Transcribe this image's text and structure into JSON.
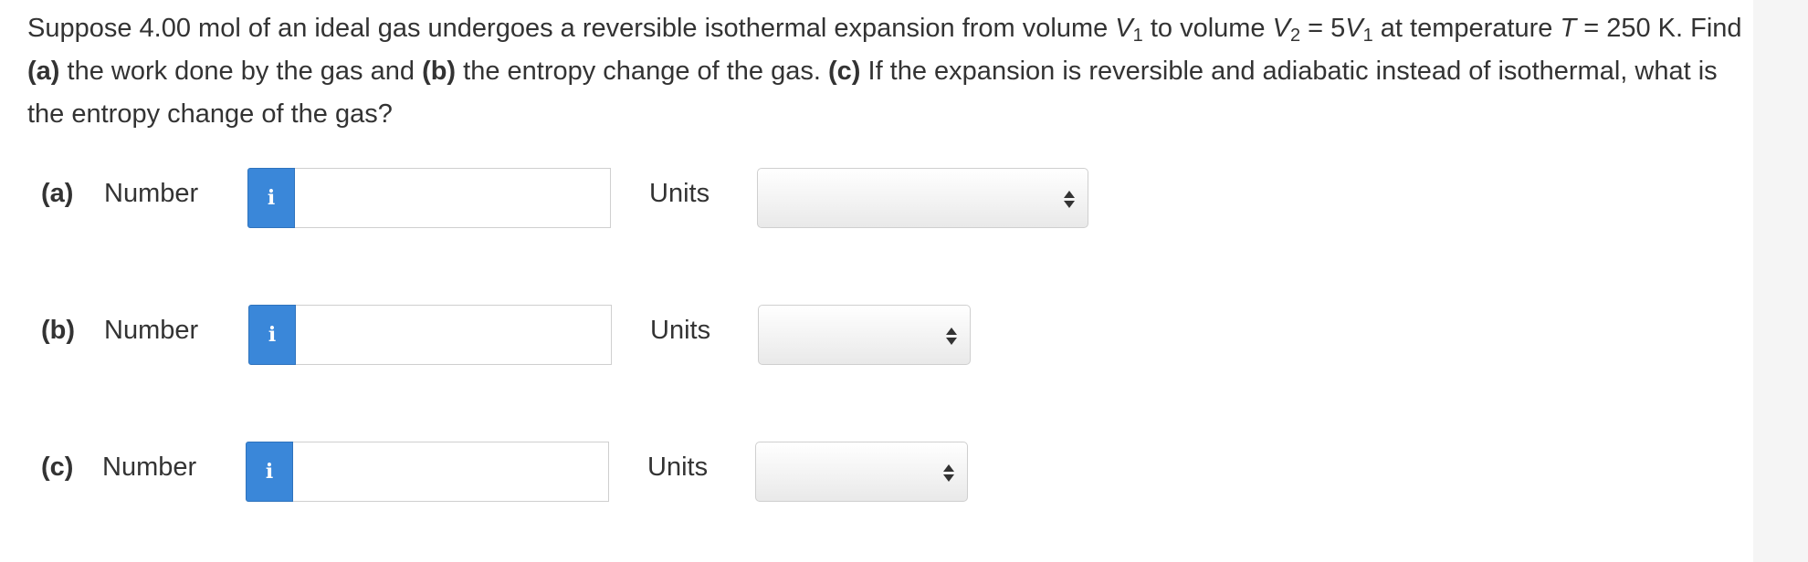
{
  "question": {
    "t1": "Suppose 4.00 mol of an ideal gas undergoes a reversible isothermal expansion from volume ",
    "v": "V",
    "sub1": "1",
    "t2": " to volume ",
    "sub2": "2",
    "t3": " = 5",
    "t4": " at temperature ",
    "T": "T",
    "t5": " = 250 K. Find ",
    "a": "(a)",
    "t6": " the work done by the gas and ",
    "b": "(b)",
    "t7": " the entropy change of the gas. ",
    "c": "(c)",
    "t8": " If the expansion is reversible and adiabatic instead of isothermal, what is the entropy change of the gas?"
  },
  "parts": [
    {
      "label": "(a)",
      "number_label": "Number",
      "info_icon": "i",
      "input_value": "",
      "units_label": "Units",
      "units_value": ""
    },
    {
      "label": "(b)",
      "number_label": "Number",
      "info_icon": "i",
      "input_value": "",
      "units_label": "Units",
      "units_value": ""
    },
    {
      "label": "(c)",
      "number_label": "Number",
      "info_icon": "i",
      "input_value": "",
      "units_label": "Units",
      "units_value": ""
    }
  ],
  "colors": {
    "info_button": "#3a87d9",
    "text": "#333333",
    "border": "#cfcfcf"
  }
}
